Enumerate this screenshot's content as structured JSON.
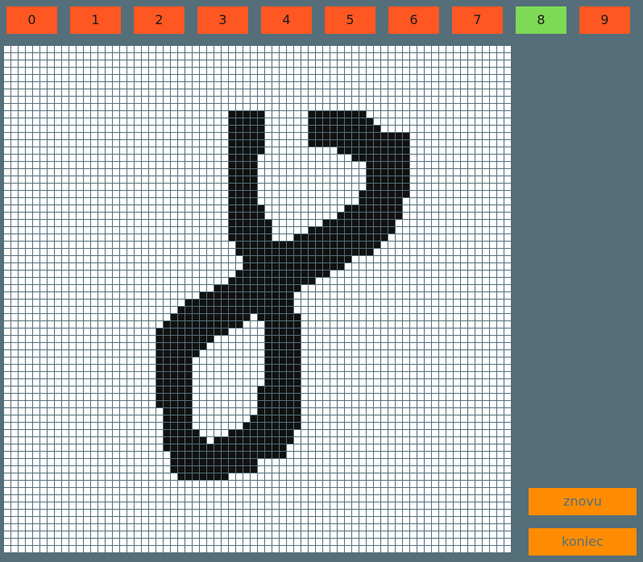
{
  "colors": {
    "background": "#546e7a",
    "digit_default": "#ff5722",
    "digit_selected": "#7ed957",
    "action_button": "#ff8c00",
    "grid_line": "#546e7a",
    "cell_filled": "#111111",
    "cell_empty": "#ffffff"
  },
  "digits": [
    {
      "label": "0",
      "selected": false
    },
    {
      "label": "1",
      "selected": false
    },
    {
      "label": "2",
      "selected": false
    },
    {
      "label": "3",
      "selected": false
    },
    {
      "label": "4",
      "selected": false
    },
    {
      "label": "5",
      "selected": false
    },
    {
      "label": "6",
      "selected": false
    },
    {
      "label": "7",
      "selected": false
    },
    {
      "label": "8",
      "selected": true
    },
    {
      "label": "9",
      "selected": false
    }
  ],
  "buttons": {
    "retry_label": "znovu",
    "quit_label": "koniec"
  },
  "grid": {
    "columns": 70,
    "rows": 70,
    "filled_runs": [
      [
        9,
        31,
        35
      ],
      [
        9,
        42,
        49
      ],
      [
        10,
        31,
        35
      ],
      [
        10,
        42,
        50
      ],
      [
        11,
        31,
        35
      ],
      [
        11,
        42,
        51
      ],
      [
        12,
        31,
        35
      ],
      [
        12,
        42,
        55
      ],
      [
        13,
        31,
        35
      ],
      [
        13,
        42,
        55
      ],
      [
        14,
        31,
        35
      ],
      [
        14,
        46,
        55
      ],
      [
        15,
        31,
        34
      ],
      [
        15,
        48,
        55
      ],
      [
        16,
        31,
        34
      ],
      [
        16,
        50,
        55
      ],
      [
        17,
        31,
        34
      ],
      [
        17,
        50,
        55
      ],
      [
        18,
        31,
        34
      ],
      [
        18,
        50,
        55
      ],
      [
        19,
        31,
        34
      ],
      [
        19,
        50,
        55
      ],
      [
        20,
        31,
        34
      ],
      [
        20,
        49,
        55
      ],
      [
        21,
        31,
        34
      ],
      [
        21,
        49,
        54
      ],
      [
        22,
        31,
        35
      ],
      [
        22,
        47,
        54
      ],
      [
        23,
        31,
        35
      ],
      [
        23,
        46,
        54
      ],
      [
        24,
        31,
        36
      ],
      [
        24,
        44,
        53
      ],
      [
        25,
        31,
        36
      ],
      [
        25,
        42,
        53
      ],
      [
        26,
        31,
        36
      ],
      [
        26,
        40,
        52
      ],
      [
        27,
        32,
        37
      ],
      [
        27,
        38,
        51
      ],
      [
        28,
        32,
        50
      ],
      [
        28,
        32,
        50
      ],
      [
        29,
        33,
        47
      ],
      [
        30,
        33,
        46
      ],
      [
        31,
        32,
        44
      ],
      [
        32,
        31,
        42
      ],
      [
        33,
        29,
        40
      ],
      [
        34,
        27,
        39
      ],
      [
        35,
        25,
        39
      ],
      [
        36,
        24,
        39
      ],
      [
        37,
        23,
        33
      ],
      [
        37,
        35,
        40
      ],
      [
        38,
        22,
        32
      ],
      [
        38,
        36,
        40
      ],
      [
        39,
        21,
        30
      ],
      [
        39,
        36,
        40
      ],
      [
        40,
        21,
        28
      ],
      [
        40,
        36,
        40
      ],
      [
        41,
        21,
        27
      ],
      [
        41,
        36,
        40
      ],
      [
        42,
        21,
        26
      ],
      [
        42,
        36,
        40
      ],
      [
        43,
        21,
        25
      ],
      [
        43,
        36,
        40
      ],
      [
        44,
        21,
        25
      ],
      [
        44,
        36,
        40
      ],
      [
        45,
        21,
        25
      ],
      [
        45,
        36,
        40
      ],
      [
        46,
        21,
        25
      ],
      [
        46,
        36,
        40
      ],
      [
        47,
        21,
        25
      ],
      [
        47,
        35,
        40
      ],
      [
        48,
        21,
        25
      ],
      [
        48,
        35,
        40
      ],
      [
        49,
        21,
        25
      ],
      [
        49,
        35,
        40
      ],
      [
        50,
        22,
        25
      ],
      [
        50,
        35,
        40
      ],
      [
        51,
        22,
        25
      ],
      [
        51,
        34,
        40
      ],
      [
        52,
        22,
        25
      ],
      [
        52,
        33,
        40
      ],
      [
        53,
        22,
        26
      ],
      [
        53,
        31,
        39
      ],
      [
        54,
        22,
        27
      ],
      [
        54,
        29,
        39
      ],
      [
        55,
        22,
        38
      ],
      [
        56,
        23,
        38
      ],
      [
        57,
        23,
        34
      ],
      [
        58,
        23,
        34
      ],
      [
        59,
        24,
        30
      ]
    ]
  }
}
